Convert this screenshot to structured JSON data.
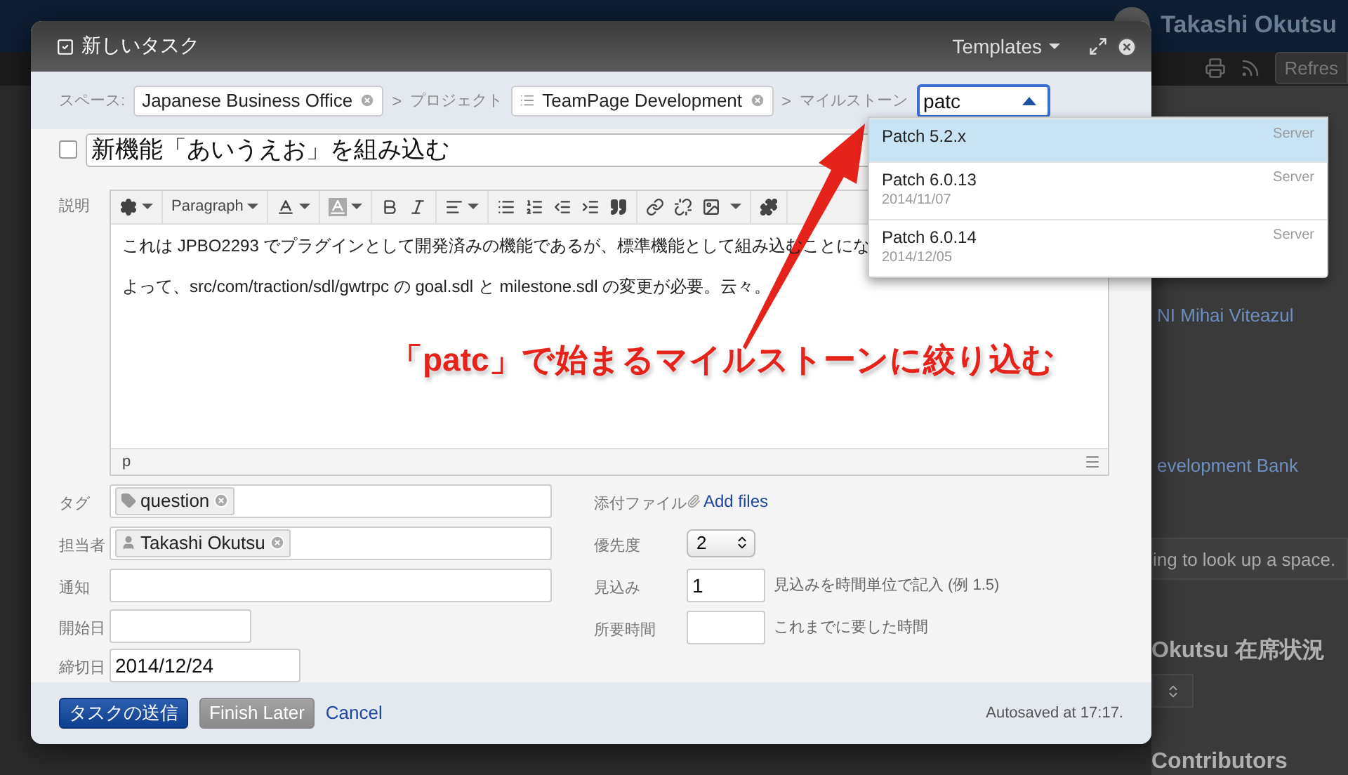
{
  "background": {
    "user_name": "Takashi Okutsu",
    "refresh_button": "Refres",
    "links": [
      "NI Mihai Viteazul",
      "evelopment Bank"
    ],
    "search_hint": "ing to look up a space.",
    "presence_title": "Okutsu 在席状況",
    "contributors_title": "Contributors"
  },
  "dialog": {
    "title": "新しいタスク",
    "templates_button": "Templates",
    "breadcrumb": {
      "space_label": "スペース:",
      "space": "Japanese Business Office",
      "project_label": "プロジェクト",
      "project": "TeamPage Development",
      "milestone_label": "マイルストーン",
      "milestone_query": "patc",
      "milestone_open": true,
      "separators": [
        ">",
        ">"
      ]
    },
    "milestone_options": [
      {
        "name": "Patch 5.2.x",
        "group": "Server",
        "selected": true
      },
      {
        "name": "Patch 6.0.13",
        "group": "Server",
        "date": "2014/11/07",
        "selected": false
      },
      {
        "name": "Patch 6.0.14",
        "group": "Server",
        "date": "2014/12/05",
        "selected": false
      }
    ],
    "task_done": false,
    "task_title": "新機能「あいうえお」を組み込む",
    "description_label": "説明",
    "format": "Paragraph",
    "description": [
      "これは JPBO2293 でプラグインとして開発済みの機能であるが、標準機能として組み込むことにな",
      "よって、src/com/traction/sdl/gwtrpc の goal.sdl と milestone.sdl の変更が必要。云々。"
    ],
    "status_path": "p",
    "left_fields": [
      {
        "label": "タグ",
        "kind": "chips",
        "chips": [
          {
            "text": "question",
            "kind": "tag"
          }
        ]
      },
      {
        "label": "担当者",
        "kind": "chips",
        "chips": [
          {
            "text": "Takashi Okutsu",
            "kind": "user"
          }
        ]
      },
      {
        "label": "通知",
        "kind": "text"
      },
      {
        "label": "開始日",
        "kind": "date"
      },
      {
        "label": "締切日",
        "kind": "date",
        "value": "2014/12/24"
      }
    ],
    "right_fields": [
      {
        "label": "添付ファイル",
        "kind": "link",
        "value": "Add files"
      },
      {
        "label": "優先度",
        "kind": "select",
        "value": "2"
      },
      {
        "label": "見込み",
        "kind": "number",
        "value": "1",
        "hint": "見込みを時間単位で記入 (例 1.5)"
      },
      {
        "label": "所要時間",
        "kind": "number",
        "hint": "これまでに要した時間"
      }
    ],
    "submit_button": "タスクの送信",
    "later_button": "Finish Later",
    "cancel_link": "Cancel",
    "autosave": "Autosaved at 17:17.",
    "annotation": "「patc」で始まるマイルストーンに絞り込む"
  }
}
